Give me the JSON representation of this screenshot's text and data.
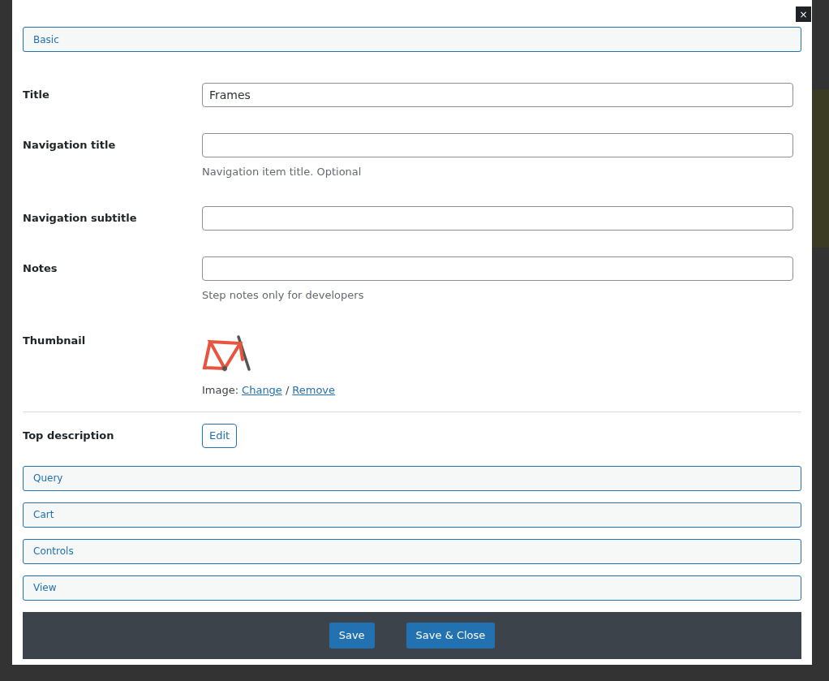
{
  "dialog": {
    "close": "×"
  },
  "sections": [
    {
      "title": "Basic",
      "fields": [
        {
          "kind": "text",
          "label": "Title",
          "value": "Frames"
        },
        {
          "kind": "text",
          "label": "Navigation title",
          "hint": "Navigation item title. Optional"
        },
        {
          "kind": "text",
          "label": "Navigation subtitle"
        },
        {
          "kind": "text",
          "label": "Notes",
          "hint": "Step notes only for developers"
        },
        {
          "kind": "image",
          "label": "Thumbnail",
          "prefix": "Image:",
          "change": "Change",
          "separator": "/",
          "remove": "Remove"
        },
        {
          "kind": "button",
          "label": "Top description",
          "button": "Edit"
        }
      ]
    },
    {
      "title": "Query"
    },
    {
      "title": "Cart"
    },
    {
      "title": "Controls"
    },
    {
      "title": "View"
    }
  ],
  "footer": {
    "buttons": [
      "Save",
      "Save & Close"
    ]
  }
}
